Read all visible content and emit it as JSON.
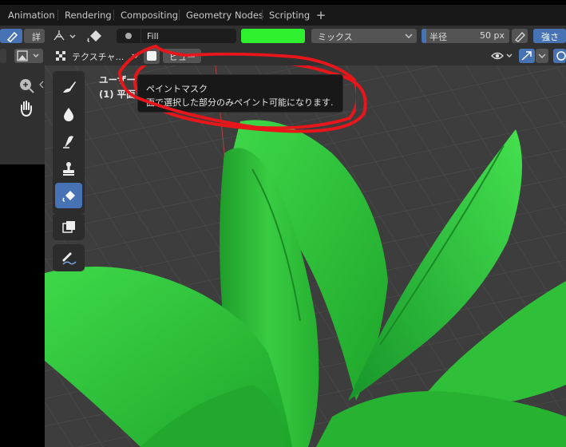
{
  "workspace_tabs": [
    "Animation",
    "Rendering",
    "Compositing",
    "Geometry Nodes",
    "Scripting"
  ],
  "tab_add": "+",
  "header": {
    "detail_label": "詳",
    "brush_name": "Fill",
    "color_hex": "#2ef02e",
    "blend_mode": "ミックス",
    "radius_label": "半径",
    "radius_value": "50 px",
    "strength_label": "強さ"
  },
  "header2": {
    "texture_label": "テクスチャ…",
    "view_label": "ビュー"
  },
  "viewport": {
    "view_name": "ユーザー",
    "object_line": "(1) 平面"
  },
  "tooltip": {
    "title": "ペイントマスク",
    "description": "面で選択した部分のみペイント可能になります."
  },
  "colors": {
    "accent_blue": "#4772b3",
    "annotation_red": "#e8161a",
    "leaf_green": "#2ec236"
  },
  "icons": [
    "draw-brush-icon",
    "soften-icon",
    "smear-icon",
    "clone-icon",
    "fill-icon",
    "mask-icon",
    "annotate-icon",
    "zoom-icon",
    "hand-icon",
    "eye-icon",
    "gizmo-icon",
    "overlay-icon"
  ]
}
